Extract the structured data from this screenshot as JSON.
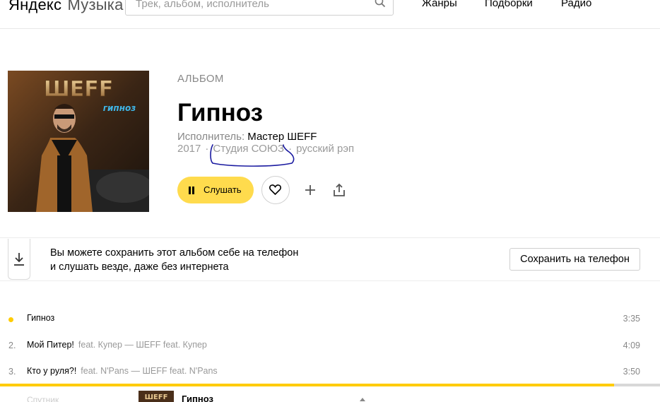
{
  "header": {
    "brand": "Яндекс",
    "section": "Музыка",
    "search_placeholder": "Трек, альбом, исполнитель",
    "nav": {
      "genres": "Жанры",
      "collections": "Подборки",
      "radio": "Радио"
    }
  },
  "album": {
    "kind": "АЛЬБОМ",
    "title": "Гипноз",
    "artist_label": "Исполнитель:",
    "artist": "Мастер ШЕFF",
    "year": "2017",
    "label": "Студия СОЮЗ",
    "genre": "русский рэп",
    "cover_text": {
      "band": "ШЕFF",
      "title": "гипноз"
    }
  },
  "actions": {
    "play_label": "Слушать"
  },
  "promo": {
    "line1": "Вы можете сохранить этот альбом себе на телефон",
    "line2": "и слушать везде, даже без интернета",
    "button": "Сохранить на телефон"
  },
  "tracks": [
    {
      "num": "",
      "title": "Гипноз",
      "feat": "",
      "duration": "3:35",
      "playing": true
    },
    {
      "num": "2.",
      "title": "Мой Питер!",
      "feat": "feat. Купер — ШЕFF feat. Купер",
      "duration": "4:09",
      "playing": false
    },
    {
      "num": "3.",
      "title": "Кто у руля?!",
      "feat": "feat. N'Pans — ШЕFF feat. N'Pans",
      "duration": "3:50",
      "playing": false
    }
  ],
  "player": {
    "title": "Гипноз",
    "progress": 0.93
  },
  "colors": {
    "accent": "#ffdb4d",
    "progress": "#ffcc00",
    "annotation": "#1a1aa0"
  }
}
